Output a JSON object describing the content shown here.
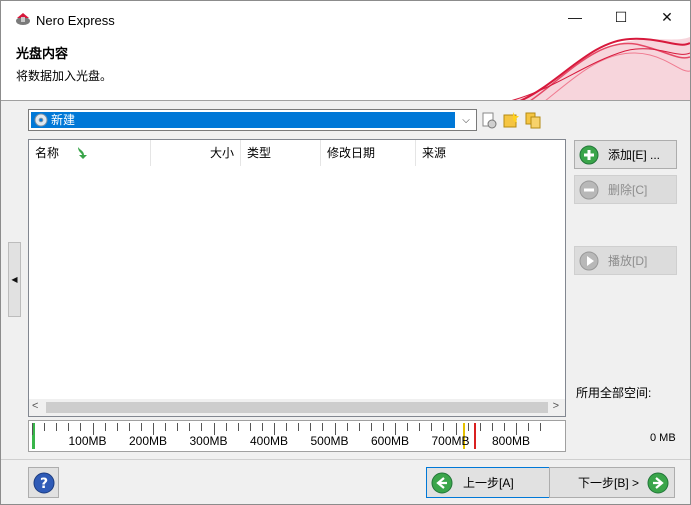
{
  "window": {
    "title": "Nero Express",
    "controls": {
      "minimize": "—",
      "maximize": "☐",
      "close": "✕"
    }
  },
  "header": {
    "title": "光盘内容",
    "subtitle": "将数据加入光盘。"
  },
  "compilation": {
    "selected": "新建",
    "arrow": "⌵"
  },
  "file_list": {
    "columns": [
      "名称",
      "大小",
      "类型",
      "修改日期",
      "来源"
    ],
    "rows": [],
    "scroll_left": "<",
    "scroll_right": ">"
  },
  "actions": {
    "add_label": "添加[E] ...",
    "delete_label": "删除[C]",
    "play_label": "播放[D]"
  },
  "space": {
    "label": "所用全部空间:",
    "value": "0 MB"
  },
  "ruler": {
    "labels": [
      "100MB",
      "200MB",
      "300MB",
      "400MB",
      "500MB",
      "600MB",
      "700MB",
      "800MB"
    ]
  },
  "nav": {
    "back_label": "上一步[A]",
    "next_label": "下一步[B] >"
  },
  "colors": {
    "selection": "#0078d7",
    "accent_wave": "#d7193c",
    "fill_green": "#39b54a",
    "limit_yellow": "#e5c100",
    "limit_red": "#d92020"
  }
}
